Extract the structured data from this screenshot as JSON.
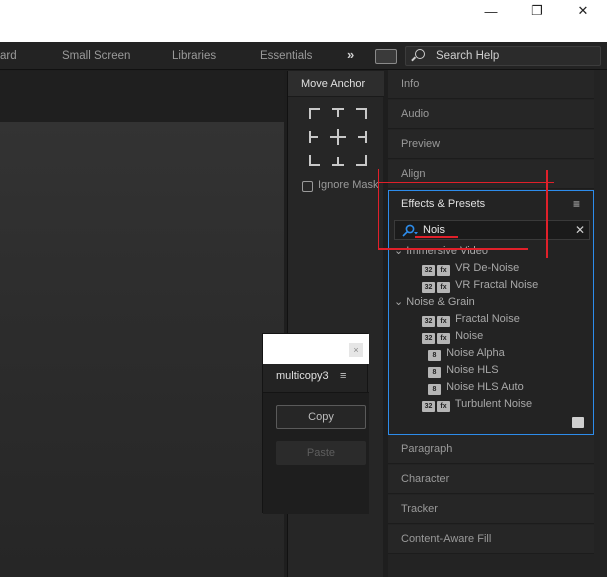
{
  "window": {
    "minimize": "—",
    "restore": "❐",
    "close": "✕"
  },
  "workspaces": [
    "ard",
    "Small Screen",
    "Libraries",
    "Essentials"
  ],
  "overflow": "»",
  "search_help": {
    "placeholder": "Search Help"
  },
  "anchor_panel": {
    "title": "Move Anchor",
    "ignore_mask_label": "Ignore Mask"
  },
  "right_panel": {
    "sections_top": [
      "Info",
      "Audio",
      "Preview",
      "Align"
    ],
    "sections_bottom": [
      "Paragraph",
      "Character",
      "Tracker",
      "Content-Aware Fill"
    ]
  },
  "effects": {
    "title": "Effects & Presets",
    "menu": "≡",
    "search_value": "Nois",
    "search_clear": "✕",
    "groups": [
      {
        "name": "Immersive Video",
        "items": [
          {
            "label": "VR De-Noise",
            "badges": [
              "32",
              "fx"
            ]
          },
          {
            "label": "VR Fractal Noise",
            "badges": [
              "32",
              "fx"
            ]
          }
        ]
      },
      {
        "name": "Noise & Grain",
        "items": [
          {
            "label": "Fractal Noise",
            "badges": [
              "32",
              "fx"
            ]
          },
          {
            "label": "Noise",
            "badges": [
              "32",
              "fx"
            ]
          },
          {
            "label": "Noise Alpha",
            "badges": [
              "8"
            ]
          },
          {
            "label": "Noise HLS",
            "badges": [
              "8"
            ]
          },
          {
            "label": "Noise HLS Auto",
            "badges": [
              "8"
            ]
          },
          {
            "label": "Turbulent Noise",
            "badges": [
              "32",
              "fx"
            ]
          }
        ]
      }
    ]
  },
  "multicopy": {
    "title": "multicopy3",
    "menu": "≡",
    "close": "×",
    "copy": "Copy",
    "paste": "Paste"
  },
  "colors": {
    "accent": "#2d8ceb",
    "annotation": "#e0202a"
  }
}
